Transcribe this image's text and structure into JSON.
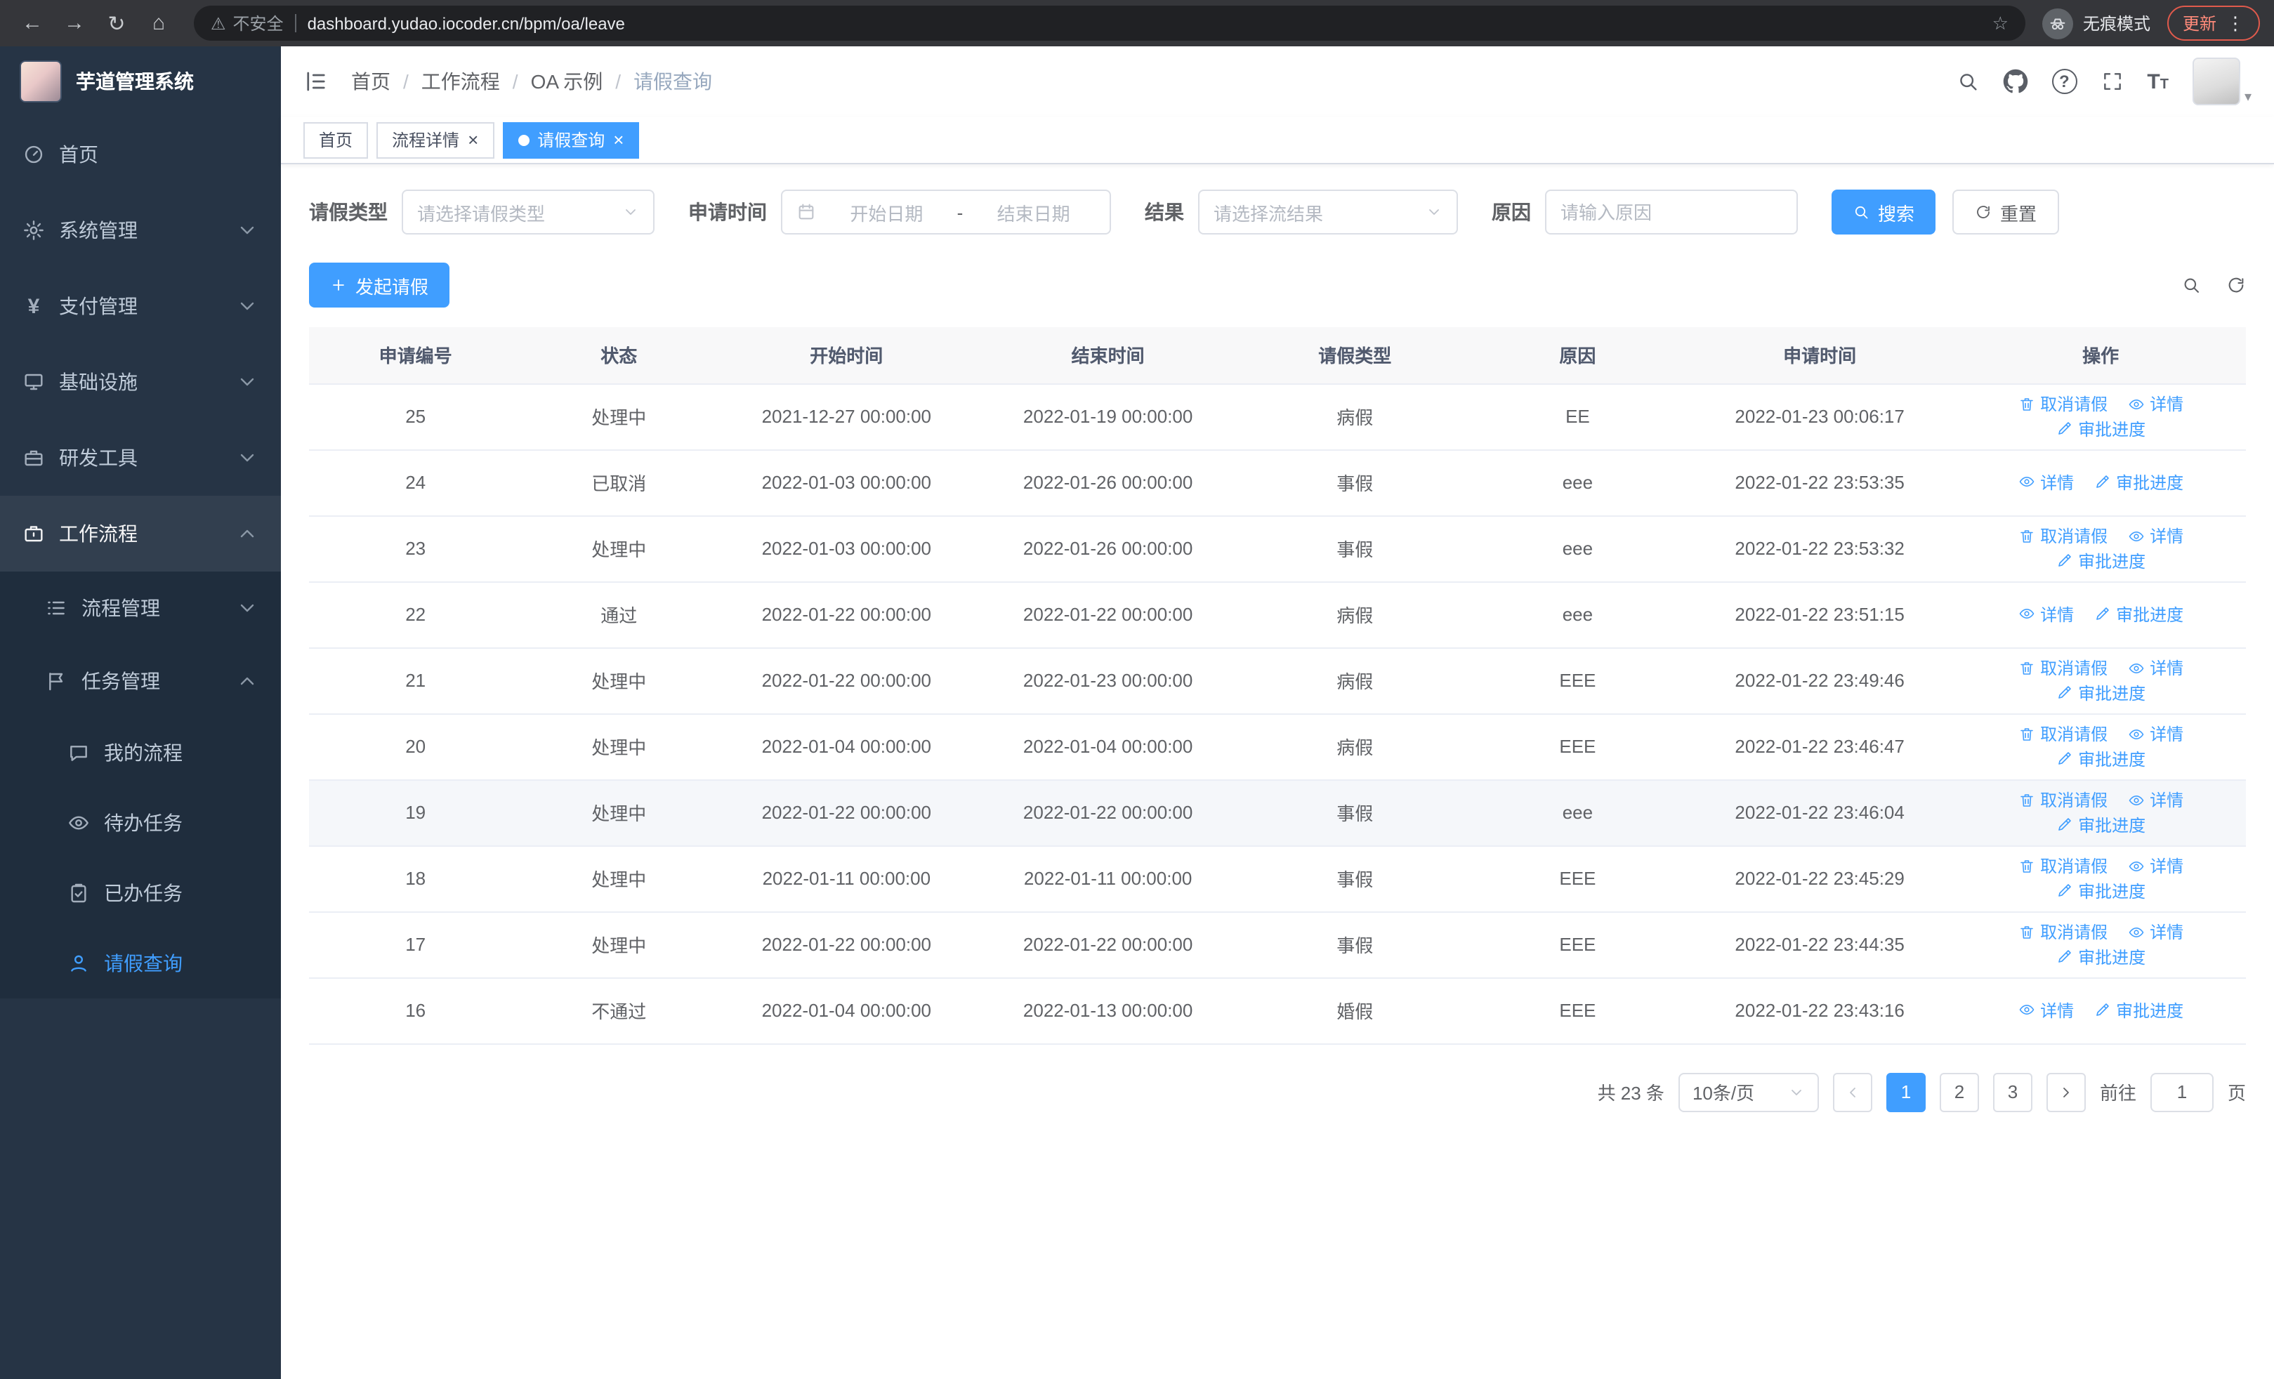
{
  "colors": {
    "primary": "#409EFF",
    "sidebar_bg": "#263445",
    "submenu_bg": "#1f2d3d",
    "update_red": "#e05a4c"
  },
  "icons": {
    "back": "←",
    "forward": "→",
    "reload": "↻",
    "home": "⌂",
    "warning": "⚠",
    "star": "☆",
    "more": "⋮",
    "close": "×",
    "yen": "¥",
    "question": "?",
    "caret_down": "▾",
    "font_large": "T",
    "font_small": "T"
  },
  "browser": {
    "security_label": "不安全",
    "url": "dashboard.yudao.iocoder.cn/bpm/oa/leave",
    "incognito_label": "无痕模式",
    "update_label": "更新"
  },
  "sidebar": {
    "title": "芋道管理系统",
    "items": [
      {
        "label": "首页"
      },
      {
        "label": "系统管理"
      },
      {
        "label": "支付管理"
      },
      {
        "label": "基础设施"
      },
      {
        "label": "研发工具"
      },
      {
        "label": "工作流程"
      },
      {
        "label": "流程管理"
      },
      {
        "label": "任务管理"
      },
      {
        "label": "我的流程"
      },
      {
        "label": "待办任务"
      },
      {
        "label": "已办任务"
      },
      {
        "label": "请假查询"
      }
    ]
  },
  "navbar": {
    "breadcrumb": [
      "首页",
      "工作流程",
      "OA 示例",
      "请假查询"
    ],
    "breadcrumb_separator": "/"
  },
  "tabs": [
    {
      "label": "首页"
    },
    {
      "label": "流程详情"
    },
    {
      "label": "请假查询"
    }
  ],
  "filters": {
    "leave_type_label": "请假类型",
    "leave_type_placeholder": "请选择请假类型",
    "apply_time_label": "申请时间",
    "start_date_placeholder": "开始日期",
    "range_separator": "-",
    "end_date_placeholder": "结束日期",
    "result_label": "结果",
    "result_placeholder": "请选择流结果",
    "reason_label": "原因",
    "reason_placeholder": "请输入原因",
    "search_label": "搜索",
    "reset_label": "重置"
  },
  "toolbar": {
    "create_label": "发起请假"
  },
  "table": {
    "columns": [
      "申请编号",
      "状态",
      "开始时间",
      "结束时间",
      "请假类型",
      "原因",
      "申请时间",
      "操作"
    ],
    "action_labels": {
      "cancel": "取消请假",
      "detail": "详情",
      "progress": "审批进度"
    },
    "rows": [
      {
        "id": "25",
        "status": "处理中",
        "start": "2021-12-27 00:00:00",
        "end": "2022-01-19 00:00:00",
        "type": "病假",
        "reason": "EE",
        "applied": "2022-01-23 00:06:17",
        "actions": [
          "cancel",
          "detail",
          "progress"
        ]
      },
      {
        "id": "24",
        "status": "已取消",
        "start": "2022-01-03 00:00:00",
        "end": "2022-01-26 00:00:00",
        "type": "事假",
        "reason": "eee",
        "applied": "2022-01-22 23:53:35",
        "actions": [
          "detail",
          "progress"
        ]
      },
      {
        "id": "23",
        "status": "处理中",
        "start": "2022-01-03 00:00:00",
        "end": "2022-01-26 00:00:00",
        "type": "事假",
        "reason": "eee",
        "applied": "2022-01-22 23:53:32",
        "actions": [
          "cancel",
          "detail",
          "progress"
        ]
      },
      {
        "id": "22",
        "status": "通过",
        "start": "2022-01-22 00:00:00",
        "end": "2022-01-22 00:00:00",
        "type": "病假",
        "reason": "eee",
        "applied": "2022-01-22 23:51:15",
        "actions": [
          "detail",
          "progress"
        ]
      },
      {
        "id": "21",
        "status": "处理中",
        "start": "2022-01-22 00:00:00",
        "end": "2022-01-23 00:00:00",
        "type": "病假",
        "reason": "EEE",
        "applied": "2022-01-22 23:49:46",
        "actions": [
          "cancel",
          "detail",
          "progress"
        ]
      },
      {
        "id": "20",
        "status": "处理中",
        "start": "2022-01-04 00:00:00",
        "end": "2022-01-04 00:00:00",
        "type": "病假",
        "reason": "EEE",
        "applied": "2022-01-22 23:46:47",
        "actions": [
          "cancel",
          "detail",
          "progress"
        ]
      },
      {
        "id": "19",
        "status": "处理中",
        "start": "2022-01-22 00:00:00",
        "end": "2022-01-22 00:00:00",
        "type": "事假",
        "reason": "eee",
        "applied": "2022-01-22 23:46:04",
        "actions": [
          "cancel",
          "detail",
          "progress"
        ],
        "hover": true
      },
      {
        "id": "18",
        "status": "处理中",
        "start": "2022-01-11 00:00:00",
        "end": "2022-01-11 00:00:00",
        "type": "事假",
        "reason": "EEE",
        "applied": "2022-01-22 23:45:29",
        "actions": [
          "cancel",
          "detail",
          "progress"
        ]
      },
      {
        "id": "17",
        "status": "处理中",
        "start": "2022-01-22 00:00:00",
        "end": "2022-01-22 00:00:00",
        "type": "事假",
        "reason": "EEE",
        "applied": "2022-01-22 23:44:35",
        "actions": [
          "cancel",
          "detail",
          "progress"
        ]
      },
      {
        "id": "16",
        "status": "不通过",
        "start": "2022-01-04 00:00:00",
        "end": "2022-01-13 00:00:00",
        "type": "婚假",
        "reason": "EEE",
        "applied": "2022-01-22 23:43:16",
        "actions": [
          "detail",
          "progress"
        ]
      }
    ]
  },
  "pagination": {
    "total_label": "共 23 条",
    "page_size_label": "10条/页",
    "pages": [
      "1",
      "2",
      "3"
    ],
    "active_page": "1",
    "goto_label": "前往",
    "goto_value": "1",
    "page_suffix_label": "页"
  }
}
